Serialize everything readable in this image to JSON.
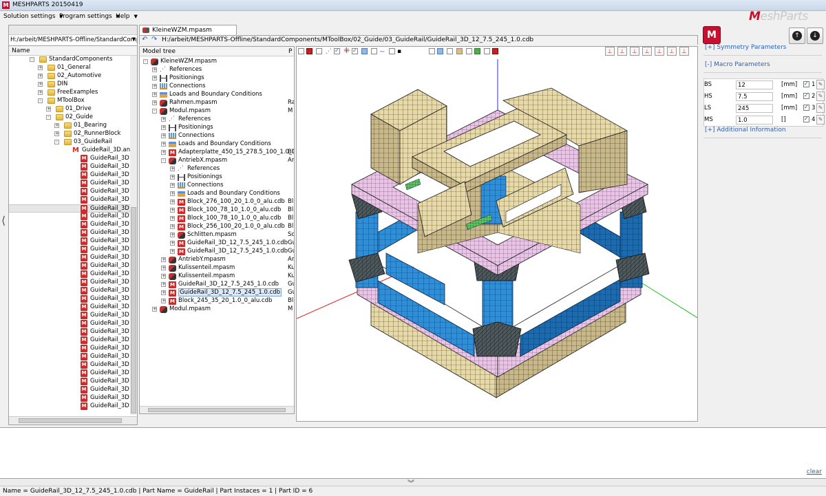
{
  "window": {
    "title": "MESHPARTS 20150419"
  },
  "menu": {
    "items": [
      "Solution settings",
      "Program settings",
      "Help"
    ]
  },
  "brand": {
    "prefix": "M",
    "text": "eshParts"
  },
  "file_browser": {
    "path": "H:/arbeit/MESHPARTS-Offline/StandardCompor",
    "column_header": "Name",
    "items": [
      {
        "label": "StandardComponents",
        "type": "folder",
        "level": 0,
        "expander": "-"
      },
      {
        "label": "01_General",
        "type": "folder",
        "level": 1,
        "expander": "+"
      },
      {
        "label": "02_Automotive",
        "type": "folder",
        "level": 1,
        "expander": "+"
      },
      {
        "label": "DIN",
        "type": "folder",
        "level": 1,
        "expander": "+"
      },
      {
        "label": "FreeExamples",
        "type": "folder",
        "level": 1,
        "expander": "+"
      },
      {
        "label": "MToolBox",
        "type": "folder",
        "level": 1,
        "expander": "-"
      },
      {
        "label": "01_Drive",
        "type": "folder",
        "level": 2,
        "expander": "+"
      },
      {
        "label": "02_Guide",
        "type": "folder",
        "level": 2,
        "expander": "-"
      },
      {
        "label": "01_Bearing",
        "type": "folder",
        "level": 3,
        "expander": "+"
      },
      {
        "label": "02_RunnerBlock",
        "type": "folder",
        "level": 3,
        "expander": "+"
      },
      {
        "label": "03_GuideRail",
        "type": "folder",
        "level": 3,
        "expander": "-"
      },
      {
        "label": "GuideRail_3D.an",
        "type": "mfile",
        "level": 4,
        "expander": ""
      },
      {
        "label": "GuideRail_3D",
        "type": "cdb",
        "level": 5,
        "expander": ""
      },
      {
        "label": "GuideRail_3D",
        "type": "cdb",
        "level": 5,
        "expander": ""
      },
      {
        "label": "GuideRail_3D",
        "type": "cdb",
        "level": 5,
        "expander": ""
      },
      {
        "label": "GuideRail_3D",
        "type": "cdb",
        "level": 5,
        "expander": ""
      },
      {
        "label": "GuideRail_3D",
        "type": "cdb",
        "level": 5,
        "expander": ""
      },
      {
        "label": "GuideRail_3D",
        "type": "cdb",
        "level": 5,
        "expander": ""
      },
      {
        "label": "GuideRail_3D",
        "type": "cdb",
        "level": 5,
        "expander": "",
        "selected": true
      },
      {
        "label": "GuideRail_3D",
        "type": "cdb",
        "level": 5,
        "expander": ""
      },
      {
        "label": "GuideRail_3D",
        "type": "cdb",
        "level": 5,
        "expander": ""
      },
      {
        "label": "GuideRail_3D",
        "type": "cdb",
        "level": 5,
        "expander": ""
      },
      {
        "label": "GuideRail_3D",
        "type": "cdb",
        "level": 5,
        "expander": ""
      },
      {
        "label": "GuideRail_3D",
        "type": "cdb",
        "level": 5,
        "expander": ""
      },
      {
        "label": "GuideRail_3D",
        "type": "cdb",
        "level": 5,
        "expander": ""
      },
      {
        "label": "GuideRail_3D",
        "type": "cdb",
        "level": 5,
        "expander": ""
      },
      {
        "label": "GuideRail_3D",
        "type": "cdb",
        "level": 5,
        "expander": ""
      },
      {
        "label": "GuideRail_3D",
        "type": "cdb",
        "level": 5,
        "expander": ""
      },
      {
        "label": "GuideRail_3D",
        "type": "cdb",
        "level": 5,
        "expander": ""
      },
      {
        "label": "GuideRail_3D",
        "type": "cdb",
        "level": 5,
        "expander": ""
      },
      {
        "label": "GuideRail_3D",
        "type": "cdb",
        "level": 5,
        "expander": ""
      },
      {
        "label": "GuideRail_3D",
        "type": "cdb",
        "level": 5,
        "expander": ""
      },
      {
        "label": "GuideRail_3D",
        "type": "cdb",
        "level": 5,
        "expander": ""
      },
      {
        "label": "GuideRail_3D",
        "type": "cdb",
        "level": 5,
        "expander": ""
      },
      {
        "label": "GuideRail_3D",
        "type": "cdb",
        "level": 5,
        "expander": ""
      },
      {
        "label": "GuideRail_3D",
        "type": "cdb",
        "level": 5,
        "expander": ""
      },
      {
        "label": "GuideRail_3D",
        "type": "cdb",
        "level": 5,
        "expander": ""
      },
      {
        "label": "GuideRail_3D",
        "type": "cdb",
        "level": 5,
        "expander": ""
      },
      {
        "label": "GuideRail_3D",
        "type": "cdb",
        "level": 5,
        "expander": ""
      },
      {
        "label": "GuideRail_3D",
        "type": "cdb",
        "level": 5,
        "expander": ""
      },
      {
        "label": "GuideRail_3D",
        "type": "cdb",
        "level": 5,
        "expander": ""
      },
      {
        "label": "GuideRail_3D",
        "type": "cdb",
        "level": 5,
        "expander": ""
      },
      {
        "label": "GuideRail_3D",
        "type": "cdb",
        "level": 5,
        "expander": ""
      }
    ]
  },
  "document": {
    "tab_label": "KleineWZM.mpasm",
    "path": "H:/arbeit/MESHPARTS-Offline/StandardComponents/MToolBox/02_Guide/03_GuideRail/GuideRail_3D_12_7.5_245_1.0.cdb"
  },
  "model_tree": {
    "header": "Model tree",
    "header2": "P",
    "rows": [
      {
        "label": "KleineWZM.mpasm",
        "icon": "asm",
        "level": 0,
        "expander": "-",
        "col2": ""
      },
      {
        "label": "References",
        "icon": "refs",
        "level": 1,
        "expander": "+",
        "col2": ""
      },
      {
        "label": "Positionings",
        "icon": "pos",
        "level": 1,
        "expander": "+",
        "col2": ""
      },
      {
        "label": "Connections",
        "icon": "conn",
        "level": 1,
        "expander": "+",
        "col2": ""
      },
      {
        "label": "Loads and Boundary Conditions",
        "icon": "lbc",
        "level": 1,
        "expander": "+",
        "col2": ""
      },
      {
        "label": "Rahmen.mpasm",
        "icon": "asm",
        "level": 1,
        "expander": "+",
        "col2": "Ra"
      },
      {
        "label": "Modul.mpasm",
        "icon": "asm",
        "level": 1,
        "expander": "-",
        "col2": "M"
      },
      {
        "label": "References",
        "icon": "refs",
        "level": 2,
        "expander": "+",
        "col2": ""
      },
      {
        "label": "Positionings",
        "icon": "pos",
        "level": 2,
        "expander": "+",
        "col2": ""
      },
      {
        "label": "Connections",
        "icon": "conn",
        "level": 2,
        "expander": "+",
        "col2": ""
      },
      {
        "label": "Loads and Boundary Conditions",
        "icon": "lbc",
        "level": 2,
        "expander": "+",
        "col2": ""
      },
      {
        "label": "Adapterplatte_450_15_278.5_100_1.0_0_alu.cdb",
        "icon": "cdb",
        "level": 2,
        "expander": "+",
        "col2": "Bl"
      },
      {
        "label": "AntriebX.mpasm",
        "icon": "asm",
        "level": 2,
        "expander": "-",
        "col2": "An"
      },
      {
        "label": "References",
        "icon": "refs",
        "level": 3,
        "expander": "+",
        "col2": ""
      },
      {
        "label": "Positionings",
        "icon": "pos",
        "level": 3,
        "expander": "+",
        "col2": ""
      },
      {
        "label": "Connections",
        "icon": "conn",
        "level": 3,
        "expander": "+",
        "col2": ""
      },
      {
        "label": "Loads and Boundary Conditions",
        "icon": "lbc",
        "level": 3,
        "expander": "+",
        "col2": ""
      },
      {
        "label": "Block_276_100_20_1.0_0_alu.cdb",
        "icon": "cdb",
        "level": 3,
        "expander": "+",
        "col2": "Bl"
      },
      {
        "label": "Block_100_78_10_1.0_0_alu.cdb",
        "icon": "cdb",
        "level": 3,
        "expander": "+",
        "col2": "Bl"
      },
      {
        "label": "Block_100_78_10_1.0_0_alu.cdb",
        "icon": "cdb",
        "level": 3,
        "expander": "+",
        "col2": "Bl"
      },
      {
        "label": "Block_256_100_20_1.0_0_alu.cdb",
        "icon": "cdb",
        "level": 3,
        "expander": "+",
        "col2": "Bl"
      },
      {
        "label": "Schlitten.mpasm",
        "icon": "asm",
        "level": 3,
        "expander": "+",
        "col2": "Sc"
      },
      {
        "label": "GuideRail_3D_12_7.5_245_1.0.cdb",
        "icon": "cdb",
        "level": 3,
        "expander": "+",
        "col2": "Gu"
      },
      {
        "label": "GuideRail_3D_12_7.5_245_1.0.cdb",
        "icon": "cdb",
        "level": 3,
        "expander": "+",
        "col2": "Gu"
      },
      {
        "label": "AntriebY.mpasm",
        "icon": "asm",
        "level": 2,
        "expander": "+",
        "col2": "An"
      },
      {
        "label": "Kulissenteil.mpasm",
        "icon": "asm",
        "level": 2,
        "expander": "+",
        "col2": "Ku"
      },
      {
        "label": "Kulissenteil.mpasm",
        "icon": "asm",
        "level": 2,
        "expander": "+",
        "col2": "Ku"
      },
      {
        "label": "GuideRail_3D_12_7.5_245_1.0.cdb",
        "icon": "cdb",
        "level": 2,
        "expander": "+",
        "col2": "Gu"
      },
      {
        "label": "GuideRail_3D_12_7.5_245_1.0.cdb",
        "icon": "cdb",
        "level": 2,
        "expander": "+",
        "col2": "Gu",
        "highlight": true
      },
      {
        "label": "Block_245_35_20_1.0_0_alu.cdb",
        "icon": "cdb",
        "level": 2,
        "expander": "+",
        "col2": "Bl"
      },
      {
        "label": "Modul.mpasm",
        "icon": "asm",
        "level": 1,
        "expander": "+",
        "col2": "M"
      }
    ]
  },
  "right_panel": {
    "logo": "M",
    "symmetry_link": "[+] Symmetry Parameters",
    "macro_link": "[-] Macro Parameters",
    "additional_link": "[+] Additional Information",
    "params": [
      {
        "name": "BS",
        "value": "12",
        "unit": "[mm]",
        "index": "1"
      },
      {
        "name": "HS",
        "value": "7.5",
        "unit": "[mm]",
        "index": "2"
      },
      {
        "name": "LS",
        "value": "245",
        "unit": "[mm]",
        "index": "3"
      },
      {
        "name": "MS",
        "value": "1.0",
        "unit": "[]",
        "index": "4"
      }
    ]
  },
  "console": {
    "clear_label": "clear"
  },
  "status": {
    "text": "Name = GuideRail_3D_12_7.5_245_1.0.cdb | Part Name = GuideRail | Part Instaces = 1 | Part ID = 6"
  },
  "colors": {
    "mesh_beige": "#e8d9a8",
    "mesh_blue": "#2e8ed8",
    "mesh_pink": "#e9c4e6",
    "mesh_dark": "#4e5a5e",
    "link_blue": "#2e62b8"
  }
}
